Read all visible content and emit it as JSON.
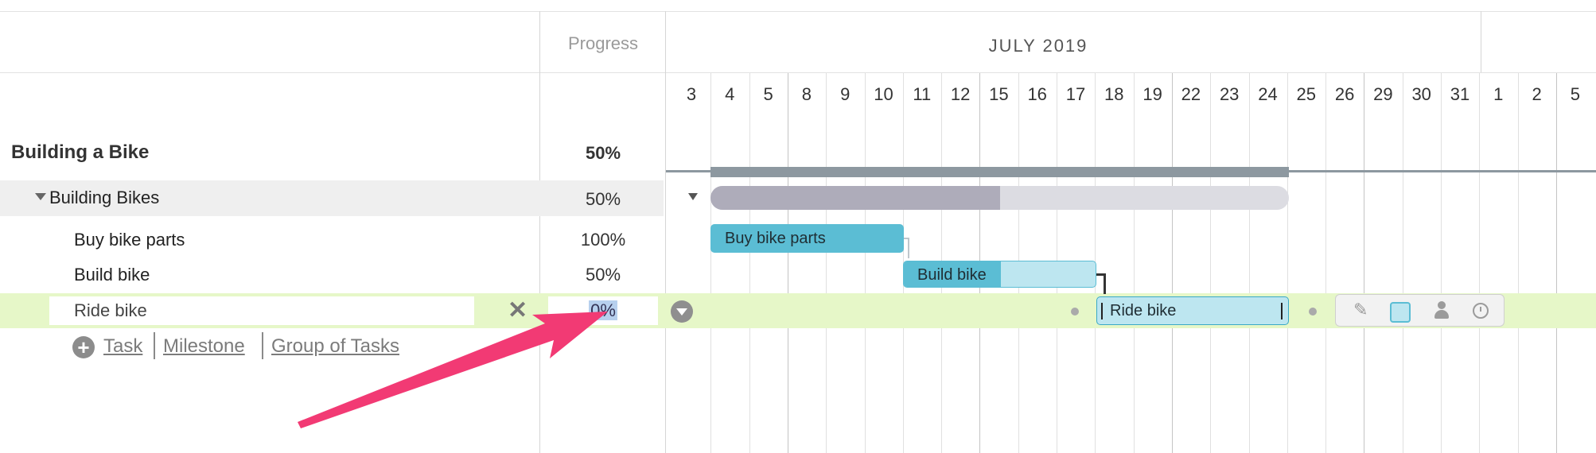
{
  "header": {
    "progress_label": "Progress",
    "month_label": "JULY 2019"
  },
  "timeline": {
    "days": [
      "3",
      "4",
      "5",
      "8",
      "9",
      "10",
      "11",
      "12",
      "15",
      "16",
      "17",
      "18",
      "19",
      "22",
      "23",
      "24",
      "25",
      "26",
      "29",
      "30",
      "31",
      "1",
      "2",
      "5"
    ]
  },
  "rows": {
    "project": {
      "name": "Building a Bike",
      "progress": "50%"
    },
    "group": {
      "name": "Building Bikes",
      "progress": "50%",
      "progress_fraction": 0.5
    },
    "tasks": [
      {
        "name": "Buy bike parts",
        "progress": "100%"
      },
      {
        "name": "Build bike",
        "progress": "50%"
      }
    ],
    "editing": {
      "name": "Ride bike",
      "progress_value": "0%"
    }
  },
  "add_links": {
    "task": "Task",
    "milestone": "Milestone",
    "group": "Group of Tasks"
  },
  "bars": {
    "buy": "Buy bike parts",
    "build": "Build bike",
    "ride": "Ride bike"
  },
  "colors": {
    "accent_blue": "#5bbdd4",
    "light_blue": "#bde6f0",
    "row_highlight": "#e6f7c8",
    "arrow": "#f23a74"
  }
}
